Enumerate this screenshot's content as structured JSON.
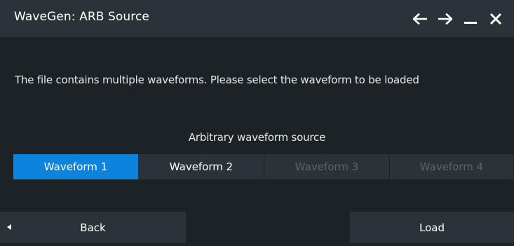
{
  "window": {
    "title": "WaveGen: ARB Source",
    "controls": [
      {
        "icon": "arrow-left-icon"
      },
      {
        "icon": "arrow-right-icon"
      },
      {
        "icon": "minimize-icon"
      },
      {
        "icon": "close-icon"
      }
    ]
  },
  "message": "The file contains multiple waveforms. Please select the waveform to be loaded",
  "waveform_source": {
    "label": "Arbitrary waveform source",
    "options": [
      {
        "label": "Waveform 1",
        "state": "selected"
      },
      {
        "label": "Waveform 2",
        "state": "enabled"
      },
      {
        "label": "Waveform 3",
        "state": "disabled"
      },
      {
        "label": "Waveform 4",
        "state": "disabled"
      }
    ]
  },
  "buttons": {
    "back": "Back",
    "load": "Load"
  },
  "colors": {
    "background": "#1c2226",
    "title_bar": "#2b3338",
    "button": "#2b3338",
    "selected": "#0a84dd",
    "disabled_text": "#5d6468"
  }
}
